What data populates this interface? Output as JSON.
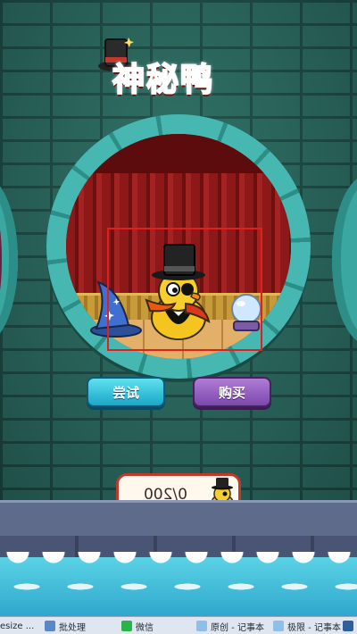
{
  "title": {
    "text": "神秘鸭"
  },
  "actions": {
    "try_label": "尝试",
    "buy_label": "购买"
  },
  "counter": {
    "text": "0/200"
  },
  "taskbar": {
    "items": [
      {
        "label": "esize ...",
        "icon": "window-icon",
        "color": "#ffffff"
      },
      {
        "label": "批处理",
        "icon": "image-tool-icon",
        "color": "#5b86c8"
      },
      {
        "label": "微信",
        "icon": "wechat-icon",
        "color": "#2bb24c"
      },
      {
        "label": "原创 - 记事本",
        "icon": "notepad-icon",
        "color": "#8fbfe6"
      },
      {
        "label": "极限 - 记事本",
        "icon": "notepad-icon",
        "color": "#8fbfe6"
      },
      {
        "label": "",
        "icon": "app-icon",
        "color": "#2f5f9a"
      }
    ]
  },
  "colors": {
    "wall": "#2a6a60",
    "ring": "#3aa7a0",
    "curtain": "#8c1818",
    "try_button": "#1aa6c8",
    "buy_button": "#7b49ad",
    "selection_box": "#e0201e",
    "water": "#2fa7cc"
  }
}
